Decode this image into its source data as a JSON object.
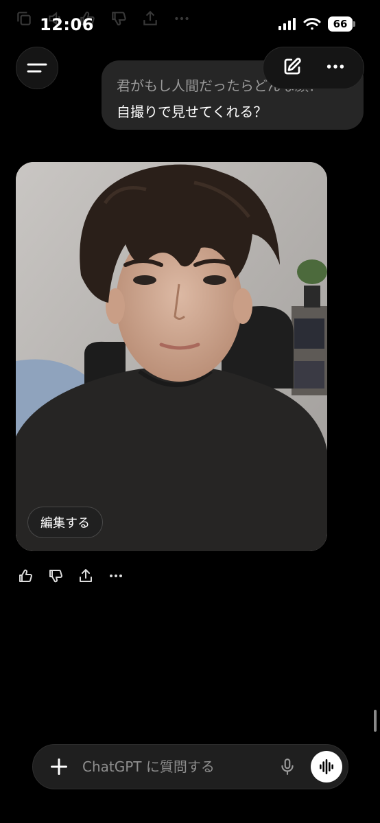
{
  "status_bar": {
    "time": "12:06",
    "battery": "66"
  },
  "top_bar": {
    "menu_icon": "hamburger-icon",
    "compose_icon": "new-chat-icon",
    "more_icon": "ellipsis-icon"
  },
  "chat": {
    "user_message": {
      "line1": "君がもし人間だったらどんな顔？",
      "line2": "自撮りで見せてくれる？"
    },
    "assistant_image": {
      "edit_label": "編集する"
    },
    "actions": [
      "thumbs-up-icon",
      "thumbs-down-icon",
      "share-icon",
      "ellipsis-icon"
    ]
  },
  "composer": {
    "placeholder": "ChatGPT に質問する",
    "plus_icon": "plus-icon",
    "mic_icon": "microphone-icon",
    "voice_icon": "voice-mode-icon"
  },
  "colors": {
    "background": "#000000",
    "bubble": "#262626",
    "composer": "#1f1f1f"
  }
}
